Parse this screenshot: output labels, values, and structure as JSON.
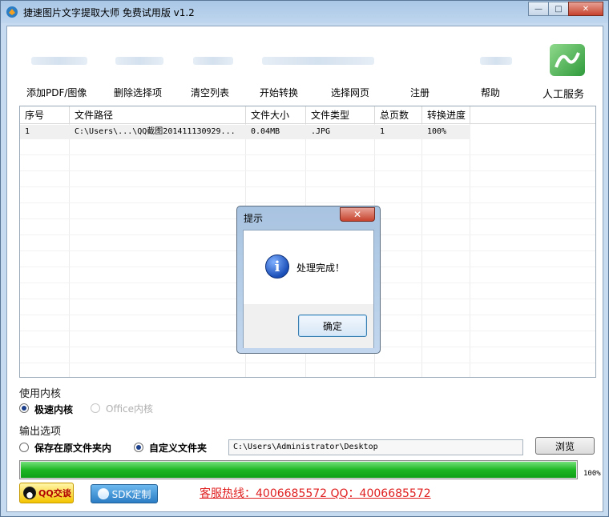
{
  "window": {
    "title": "捷速图片文字提取大师 免费试用版 v1.2",
    "caption_min": "—",
    "caption_max": "□",
    "caption_close": "✕"
  },
  "menu": [
    {
      "label": "添加PDF/图像"
    },
    {
      "label": "删除选择项"
    },
    {
      "label": "清空列表"
    },
    {
      "label": "开始转换"
    },
    {
      "label": "选择网页"
    },
    {
      "label": "注册"
    },
    {
      "label": "帮助"
    },
    {
      "label": "人工服务"
    }
  ],
  "table": {
    "columns": [
      "序号",
      "文件路径",
      "文件大小",
      "文件类型",
      "总页数",
      "转换进度"
    ],
    "rows": [
      {
        "index": "1",
        "path": "C:\\Users\\...\\QQ截图201411130929...",
        "size": "0.04MB",
        "type": ".JPG",
        "pages": "1",
        "progress": "100%"
      }
    ]
  },
  "dialog": {
    "title": "提示",
    "close": "✕",
    "icon": "info-icon",
    "message": "处理完成！",
    "ok_label": "确定"
  },
  "options": {
    "engine_label": "使用内核",
    "engine_fast": "极速内核",
    "engine_office": "Office内核",
    "output_label": "输出选项",
    "save_original": "保存在原文件夹内",
    "custom_folder": "自定义文件夹",
    "path_value": "C:\\Users\\Administrator\\Desktop",
    "browse_label": "浏览"
  },
  "progress": {
    "value": 1.0,
    "label": "100%",
    "color": "#1fb625"
  },
  "footer": {
    "qq_label": "QQ交谈",
    "sdk_label": "SDK定制",
    "hotline": "客服热线：4006685572 QQ：4006685572"
  },
  "colors": {
    "hotline": "#e02020",
    "dialog_frame": "#a8c3e0"
  }
}
